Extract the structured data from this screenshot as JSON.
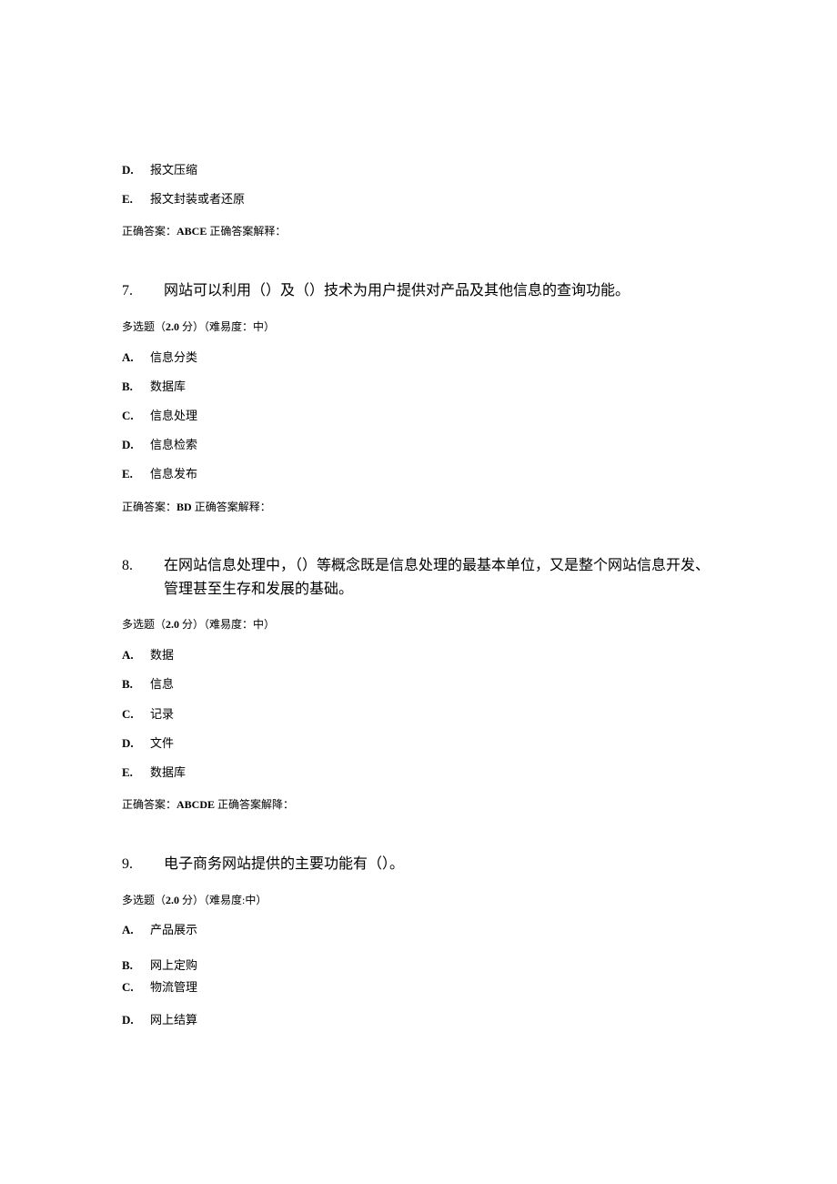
{
  "q6_tail": {
    "options": [
      {
        "letter": "D.",
        "text": "报文压缩"
      },
      {
        "letter": "E.",
        "text": "报文封装或者还原"
      }
    ],
    "answer_prefix": "正确答案：",
    "answer_value": "ABCE",
    "answer_suffix": " 正确答案解释："
  },
  "q7": {
    "num": "7.",
    "title": "网站可以利用（）及（）技术为用户提供对产品及其他信息的查询功能。",
    "meta_a": "多选题（",
    "meta_b": "2.0",
    "meta_c": " 分）（难易度：中）",
    "options": [
      {
        "letter": "A.",
        "text": "信息分类"
      },
      {
        "letter": "B.",
        "text": "数据库"
      },
      {
        "letter": "C.",
        "text": "信息处理"
      },
      {
        "letter": "D.",
        "text": "信息检索"
      },
      {
        "letter": "E.",
        "text": "信息发布"
      }
    ],
    "answer_prefix": "正确答案：",
    "answer_value": "BD",
    "answer_suffix": " 正确答案解释："
  },
  "q8": {
    "num": "8.",
    "title": "在网站信息处理中，（）等概念既是信息处理的最基本单位，又是整个网站信息开发、管理甚至生存和发展的基础。",
    "meta_a": "多选题（",
    "meta_b": "2.0",
    "meta_c": " 分）（难易度：中）",
    "options": [
      {
        "letter": "A.",
        "text": "数据"
      },
      {
        "letter": "B.",
        "text": "信息"
      },
      {
        "letter": "C.",
        "text": "记录"
      },
      {
        "letter": "D.",
        "text": "文件"
      },
      {
        "letter": "E.",
        "text": "数据库"
      }
    ],
    "answer_prefix": "正确答案：",
    "answer_value": "ABCDE",
    "answer_suffix": " 正确答案解降："
  },
  "q9": {
    "num": "9.",
    "title": "电子商务网站提供的主要功能有（）。",
    "meta_a": "多选题（",
    "meta_b": "2.0",
    "meta_c": " 分）（难易度:中）",
    "options": [
      {
        "letter": "A.",
        "text": "产品展示"
      },
      {
        "letter": "B.",
        "text": "网上定购"
      },
      {
        "letter": "C.",
        "text": "物流管理"
      },
      {
        "letter": "D.",
        "text": "网上结算"
      }
    ]
  }
}
